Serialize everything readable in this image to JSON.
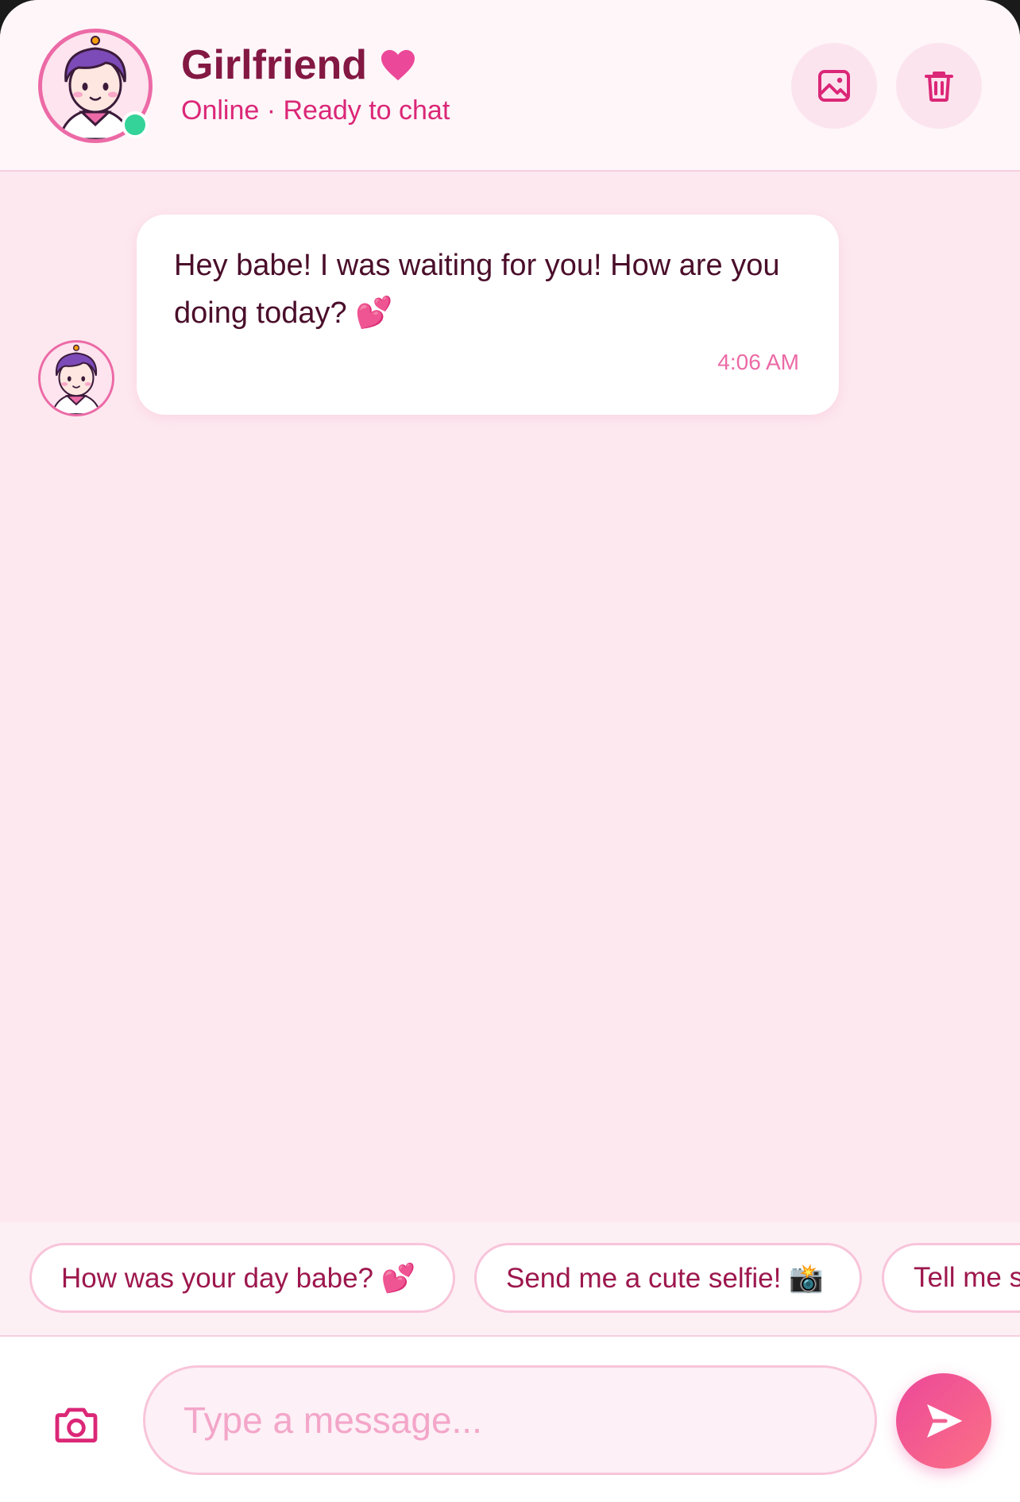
{
  "header": {
    "name": "Girlfriend",
    "status": "Online · Ready to chat",
    "online": true,
    "gallery_icon": "image-icon",
    "delete_icon": "trash-icon"
  },
  "messages": [
    {
      "sender": "assistant",
      "text": "Hey babe! I was waiting for you! How are you doing today? 💕",
      "time": "4:06 AM"
    }
  ],
  "suggestions": [
    "How was your day babe? 💕",
    "Send me a cute selfie! 📸",
    "Tell me s"
  ],
  "composer": {
    "placeholder": "Type a message...",
    "camera_icon": "camera-icon",
    "send_icon": "send-icon"
  },
  "colors": {
    "accent": "#ec4899",
    "header_bg": "#fef6f9",
    "chat_bg": "#fde8ef",
    "name": "#831843",
    "status": "#db2777",
    "online": "#34d399"
  }
}
